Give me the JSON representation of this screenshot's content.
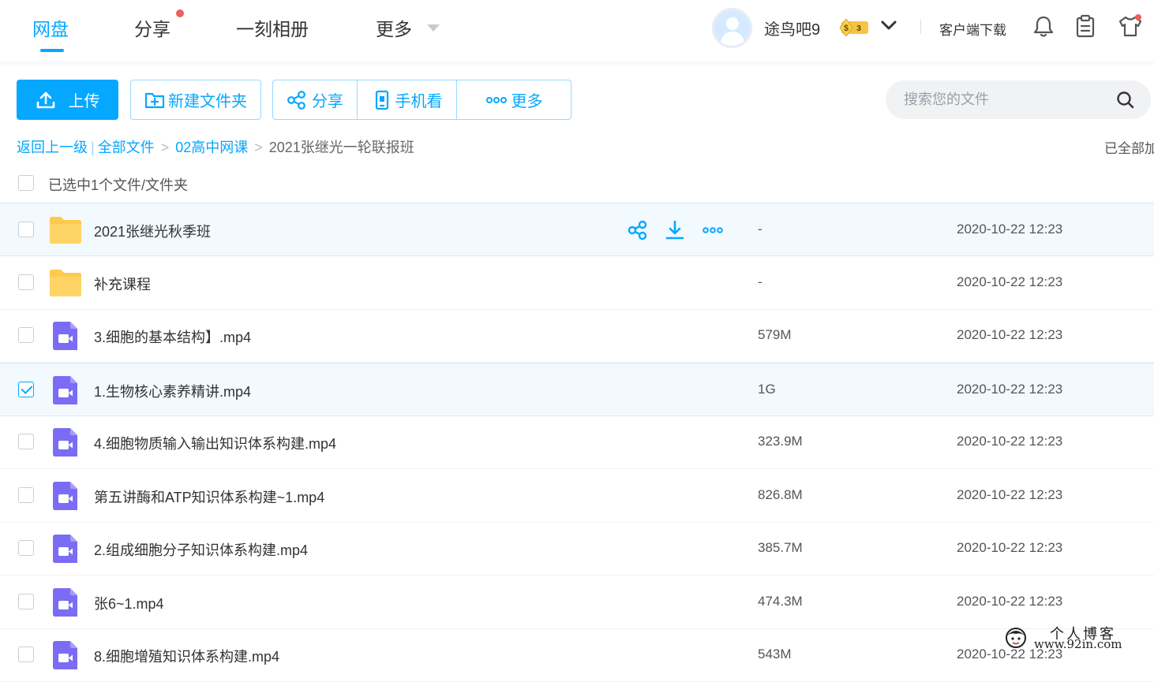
{
  "nav": {
    "tabs": [
      {
        "label": "网盘",
        "active": true
      },
      {
        "label": "分享",
        "has_dot": true
      },
      {
        "label": "一刻相册"
      },
      {
        "label": "更多"
      }
    ]
  },
  "user": {
    "name": "途鸟吧9",
    "vip_level": "3",
    "vip_symbol": "$"
  },
  "header": {
    "client_download": "客户端下载"
  },
  "toolbar": {
    "upload": "上传",
    "new_folder": "新建文件夹",
    "share": "分享",
    "phone_view": "手机看",
    "more": "更多"
  },
  "search": {
    "placeholder": "搜索您的文件"
  },
  "breadcrumb": {
    "back": "返回上一级",
    "sep_bar": "|",
    "sep_gt": ">",
    "all_files": "全部文件",
    "level1": "02高中网课",
    "current": "2021张继光一轮联报班"
  },
  "status": {
    "loaded": "已全部加载"
  },
  "selection": {
    "info": "已选中1个文件/文件夹"
  },
  "files": [
    {
      "name": "2021张继光秋季班",
      "type": "folder",
      "size": "-",
      "date": "2020-10-22 12:23",
      "checked": false,
      "hover": true
    },
    {
      "name": "补充课程",
      "type": "folder",
      "size": "-",
      "date": "2020-10-22 12:23",
      "checked": false
    },
    {
      "name": "3.细胞的基本结构】.mp4",
      "type": "video",
      "size": "579M",
      "date": "2020-10-22 12:23",
      "checked": false
    },
    {
      "name": "1.生物核心素养精讲.mp4",
      "type": "video",
      "size": "1G",
      "date": "2020-10-22 12:23",
      "checked": true
    },
    {
      "name": "4.细胞物质输入输出知识体系构建.mp4",
      "type": "video",
      "size": "323.9M",
      "date": "2020-10-22 12:23",
      "checked": false
    },
    {
      "name": "第五讲酶和ATP知识体系构建~1.mp4",
      "type": "video",
      "size": "826.8M",
      "date": "2020-10-22 12:23",
      "checked": false
    },
    {
      "name": "2.组成细胞分子知识体系构建.mp4",
      "type": "video",
      "size": "385.7M",
      "date": "2020-10-22 12:23",
      "checked": false
    },
    {
      "name": "张6~1.mp4",
      "type": "video",
      "size": "474.3M",
      "date": "2020-10-22 12:23",
      "checked": false
    },
    {
      "name": "8.细胞增殖知识体系构建.mp4",
      "type": "video",
      "size": "543M",
      "date": "2020-10-22 12:23",
      "checked": false
    }
  ],
  "watermark": {
    "title": "个人博客",
    "url": "www.92in.com"
  },
  "colors": {
    "accent": "#06a7ff",
    "folder": "#ffd466",
    "video": "#7b6cf6",
    "dot": "#f25d5d"
  },
  "icons": {
    "upload": "upload-icon",
    "new_folder": "folder-plus-icon",
    "share": "share-icon",
    "phone": "phone-icon",
    "more": "ellipsis-icon",
    "search": "search-icon",
    "bell": "bell-icon",
    "clipboard": "clipboard-icon",
    "shirt": "shirt-icon",
    "download": "download-icon",
    "folder": "folder-icon",
    "video": "video-file-icon"
  }
}
